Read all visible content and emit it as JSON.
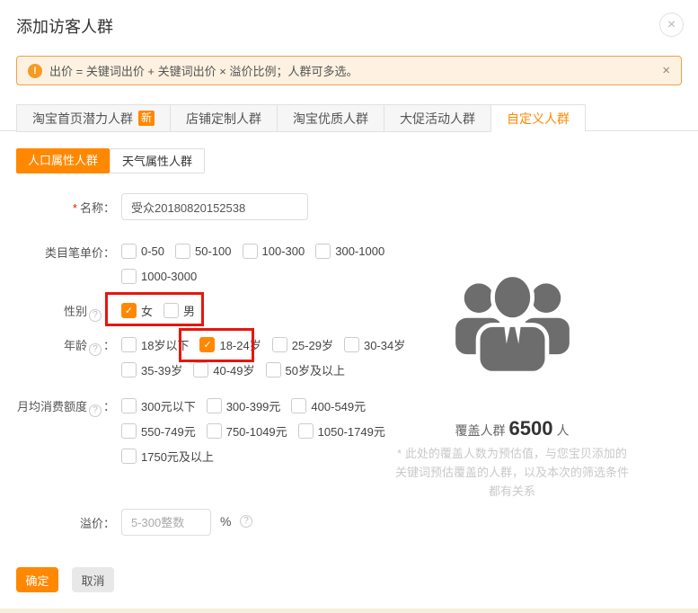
{
  "icons": {
    "close": "×",
    "help": "?",
    "alert": "!",
    "check": "✓"
  },
  "dialog": {
    "title": "添加访客人群"
  },
  "notice": {
    "text": "出价 = 关键词出价 + 关键词出价 × 溢价比例；人群可多选。"
  },
  "tabs": [
    {
      "label": "淘宝首页潜力人群",
      "badge": "新",
      "active": false
    },
    {
      "label": "店铺定制人群",
      "active": false
    },
    {
      "label": "淘宝优质人群",
      "active": false
    },
    {
      "label": "大促活动人群",
      "active": false
    },
    {
      "label": "自定义人群",
      "active": true
    }
  ],
  "subtabs": [
    {
      "label": "人口属性人群",
      "active": true
    },
    {
      "label": "天气属性人群",
      "active": false
    }
  ],
  "form": {
    "name": {
      "required": "*",
      "label": "名称：",
      "value": "受众20180820152538"
    },
    "cat_price": {
      "label": "类目笔单价：",
      "options": [
        {
          "label": "0-50",
          "checked": false
        },
        {
          "label": "50-100",
          "checked": false
        },
        {
          "label": "100-300",
          "checked": false
        },
        {
          "label": "300-1000",
          "checked": false
        },
        {
          "label": "1000-3000",
          "checked": false
        }
      ]
    },
    "gender": {
      "label": "性别",
      "colon": "：",
      "options": [
        {
          "label": "女",
          "checked": true
        },
        {
          "label": "男",
          "checked": false
        }
      ]
    },
    "age": {
      "label": "年龄",
      "colon": "：",
      "options": [
        {
          "label": "18岁以下",
          "checked": false
        },
        {
          "label": "18-24岁",
          "checked": true
        },
        {
          "label": "25-29岁",
          "checked": false
        },
        {
          "label": "30-34岁",
          "checked": false
        },
        {
          "label": "35-39岁",
          "checked": false
        },
        {
          "label": "40-49岁",
          "checked": false
        },
        {
          "label": "50岁及以上",
          "checked": false
        }
      ]
    },
    "monthly_spend": {
      "label": "月均消费额度",
      "colon": "：",
      "options": [
        {
          "label": "300元以下",
          "checked": false
        },
        {
          "label": "300-399元",
          "checked": false
        },
        {
          "label": "400-549元",
          "checked": false
        },
        {
          "label": "550-749元",
          "checked": false
        },
        {
          "label": "750-1049元",
          "checked": false
        },
        {
          "label": "1050-1749元",
          "checked": false
        },
        {
          "label": "1750元及以上",
          "checked": false
        }
      ]
    },
    "premium": {
      "label": "溢价：",
      "placeholder": "5-300整数",
      "unit": "%"
    }
  },
  "coverage": {
    "label": "覆盖人群",
    "value": "6500",
    "unit": "人",
    "note_lines": [
      "* 此处的覆盖人数为预估值，与您宝贝添加的",
      "关键词预估覆盖的人群，以及本次的筛选条件",
      "都有关系"
    ]
  },
  "footer": {
    "confirm": "确定",
    "cancel": "取消"
  },
  "colors": {
    "accent": "#ff8800",
    "annotation_red": "#e8160c",
    "people_icon_gray": "#6d6d6d"
  }
}
